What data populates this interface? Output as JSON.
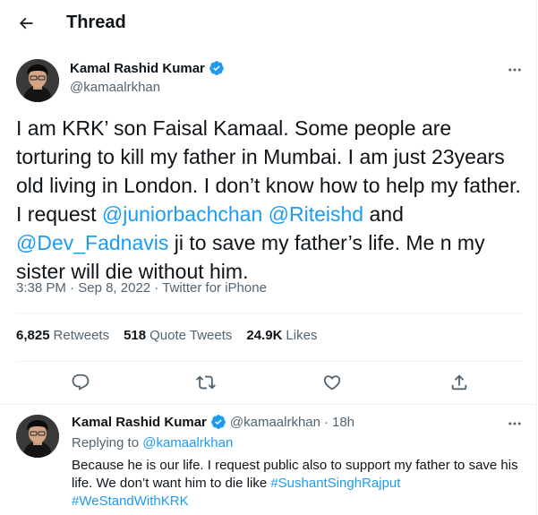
{
  "header": {
    "title": "Thread"
  },
  "main_tweet": {
    "author_name": "Kamal Rashid Kumar",
    "author_handle": "@kamaalrkhan",
    "text_part1": "I am KRK’ son Faisal Kamaal. Some people are torturing to kill my father in Mumbai. I am just 23years old living in London. I don’t know how to help my father. I request ",
    "mention1": "@juniorbachchan",
    "mention2": "@Riteishd",
    "text_and": " and ",
    "mention3": "@Dev_Fadnavis",
    "text_part2": " ji to save my father’s life. Me n my sister will die without him.",
    "time": "3:38 PM",
    "date": "Sep 8, 2022",
    "source": "Twitter for iPhone",
    "stats": {
      "retweets_count": "6,825",
      "retweets_label": "Retweets",
      "quotes_count": "518",
      "quotes_label": "Quote Tweets",
      "likes_count": "24.9K",
      "likes_label": "Likes"
    }
  },
  "reply": {
    "author_name": "Kamal Rashid Kumar",
    "author_handle": "@kamaalrkhan",
    "time_ago": "18h",
    "replying_label": "Replying to",
    "replying_to": "@kamaalrkhan",
    "text_part1": "Because he is our life. I request public also to support my father to save his life. We don’t want him to die like ",
    "hashtag1": "#SushantSinghRajput",
    "hashtag2": "#WeStandWithKRK"
  },
  "colors": {
    "accent": "#1d9bf0",
    "text": "#0f1419",
    "muted": "#536471"
  },
  "icons": [
    "back-arrow-icon",
    "verified-badge-icon",
    "more-icon",
    "reply-icon",
    "retweet-icon",
    "like-icon",
    "share-icon"
  ]
}
